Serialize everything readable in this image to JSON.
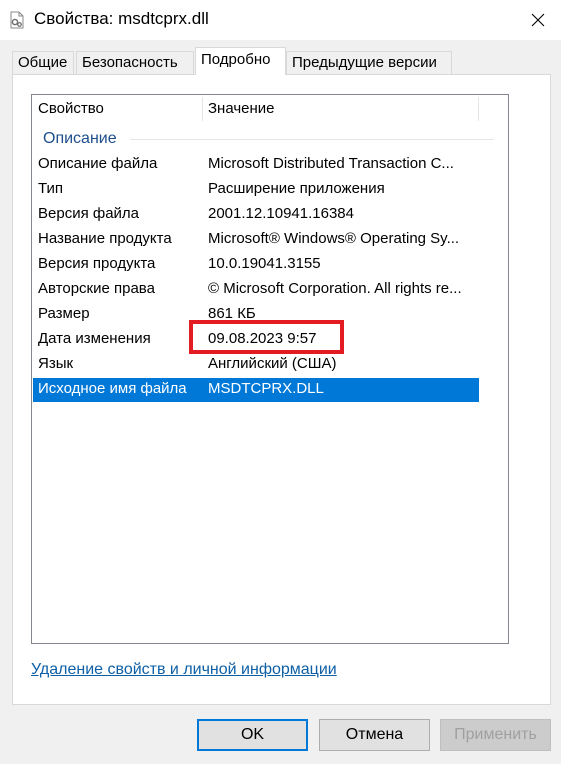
{
  "window": {
    "title": "Свойства: msdtcprx.dll"
  },
  "tabs": [
    {
      "label": "Общие"
    },
    {
      "label": "Безопасность"
    },
    {
      "label": "Подробно"
    },
    {
      "label": "Предыдущие версии"
    }
  ],
  "list": {
    "col_property": "Свойство",
    "col_value": "Значение",
    "group": "Описание",
    "rows": [
      {
        "prop": "Описание файла",
        "value": "Microsoft Distributed Transaction C..."
      },
      {
        "prop": "Тип",
        "value": "Расширение приложения"
      },
      {
        "prop": "Версия файла",
        "value": "2001.12.10941.16384"
      },
      {
        "prop": "Название продукта",
        "value": "Microsoft® Windows® Operating Sy..."
      },
      {
        "prop": "Версия продукта",
        "value": "10.0.19041.3155"
      },
      {
        "prop": "Авторские права",
        "value": "© Microsoft Corporation. All rights re..."
      },
      {
        "prop": "Размер",
        "value": "861 КБ"
      },
      {
        "prop": "Дата изменения",
        "value": "09.08.2023 9:57"
      },
      {
        "prop": "Язык",
        "value": "Английский (США)"
      },
      {
        "prop": "Исходное имя файла",
        "value": "MSDTCPRX.DLL"
      }
    ]
  },
  "link": "Удаление свойств и личной информации",
  "buttons": {
    "ok": "OK",
    "cancel": "Отмена",
    "apply": "Применить"
  },
  "colors": {
    "selection": "#0078d7",
    "highlight_box": "#e31b23",
    "group_title": "#1e4e8c"
  }
}
